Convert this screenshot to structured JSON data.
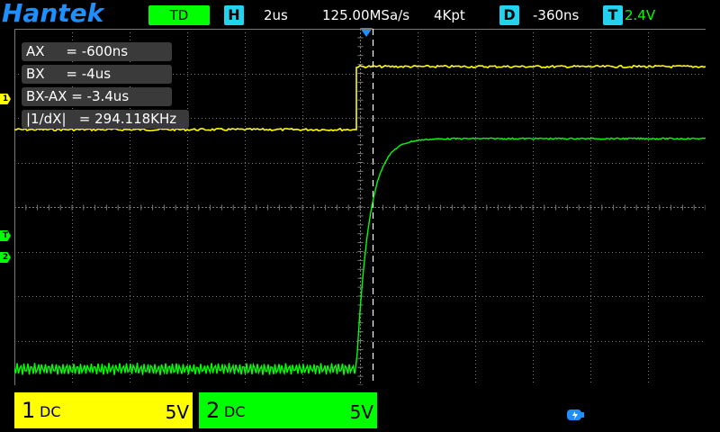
{
  "brand": "Hantek",
  "header": {
    "mode": "TD",
    "h_label": "H",
    "timebase": "2us",
    "sample_rate": "125.00MSa/s",
    "memory_depth": "4Kpt",
    "d_label": "D",
    "delay": "-360ns",
    "t_label": "T",
    "trigger_level": "2.4V"
  },
  "cursor_readouts": [
    "AX     = -600ns",
    "BX     = -4us",
    "BX-AX = -3.4us",
    "|1/dX|   = 294.118KHz"
  ],
  "markers": {
    "ch1": "1",
    "trig": "T",
    "ch2": "2"
  },
  "channels": {
    "ch1": {
      "num": "1",
      "coupling": "DC",
      "scale": "5V"
    },
    "ch2": {
      "num": "2",
      "coupling": "DC",
      "scale": "5V"
    }
  },
  "colors": {
    "ch1": "#ffff00",
    "ch2": "#00ff00",
    "accent": "#1e8fff",
    "badge": "#22d3ee"
  }
}
